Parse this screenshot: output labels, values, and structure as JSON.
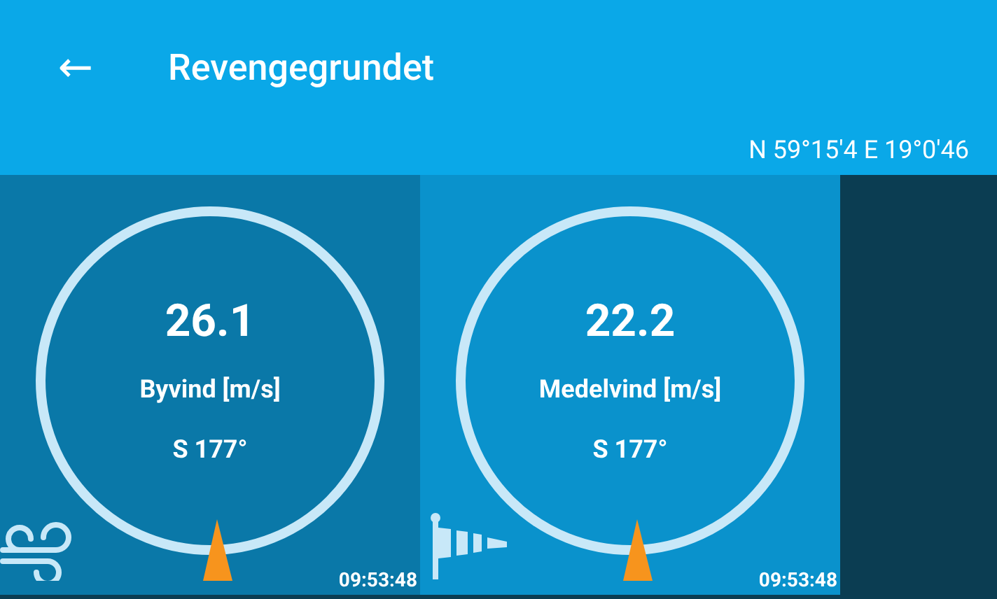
{
  "app_bar": {
    "back": "←",
    "title": "Revengegrundet"
  },
  "coordinates": "N 59°15'4 E 19°0'46",
  "cards": [
    {
      "kind": "gust",
      "value": "26.1",
      "label": "Byvind [m/s]",
      "direction": "S 177°",
      "time": "09:53:48"
    },
    {
      "kind": "mean",
      "value": "22.2",
      "label": "Medelvind [m/s]",
      "direction": "S 177°",
      "time": "09:53:48"
    }
  ]
}
